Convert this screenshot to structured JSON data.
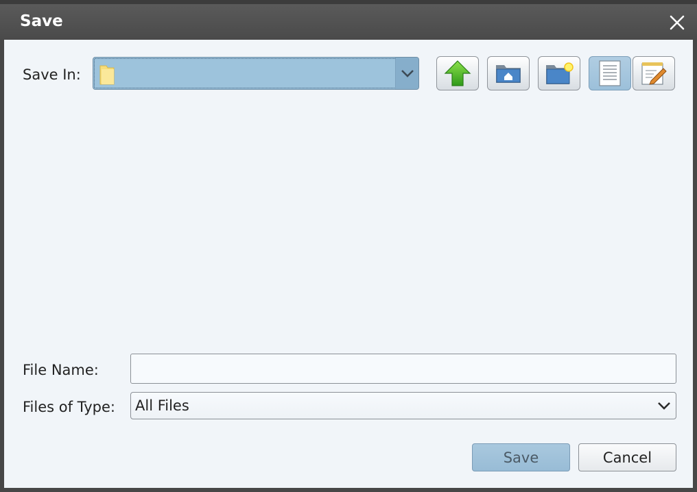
{
  "window": {
    "title": "Save"
  },
  "toolbar": {
    "save_in_label": "Save In:",
    "save_in_value": "",
    "buttons": [
      "up-folder",
      "home-folder",
      "new-folder",
      "list-view",
      "details-view"
    ]
  },
  "form": {
    "file_name_label": "File Name:",
    "file_name_value": "",
    "files_of_type_label": "Files of Type:",
    "files_of_type_value": "All Files"
  },
  "actions": {
    "save_label": "Save",
    "cancel_label": "Cancel"
  },
  "colors": {
    "accent": "#9dc3dc",
    "titlebar": "#4a4a4a",
    "background": "#f1f5f9"
  }
}
